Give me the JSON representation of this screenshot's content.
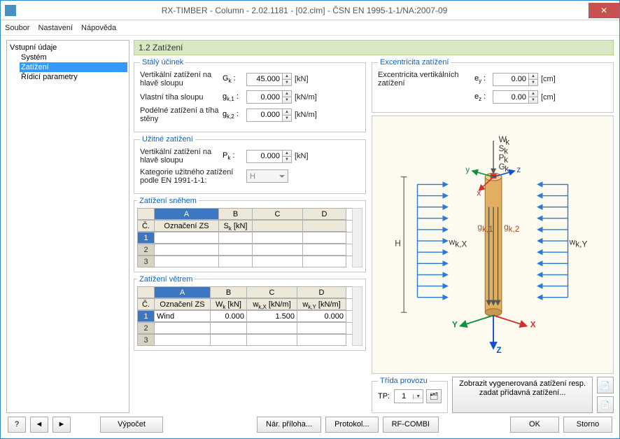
{
  "title": "RX-TIMBER - Column - 2.02.1181 - [02.clm] - ČSN EN 1995-1-1/NA:2007-09",
  "menu": {
    "file": "Soubor",
    "settings": "Nastavení",
    "help": "Nápověda"
  },
  "tree": {
    "root": "Vstupní údaje",
    "items": [
      "Systém",
      "Zatížení",
      "Řídicí parametry"
    ],
    "selected": "Zatížení"
  },
  "heading": "1.2 Zatížení",
  "perm": {
    "legend": "Stálý účinek",
    "r1_label": "Vertikální zatížení na hlavě sloupu",
    "r1_sym": "G<sub>k</sub> :",
    "r1_val": "45.000",
    "r1_unit": "[kN]",
    "r2_label": "Vlastní tíha sloupu",
    "r2_sym": "g<sub>k,1</sub> :",
    "r2_val": "0.000",
    "r2_unit": "[kN/m]",
    "r3_label": "Podélné zatížení a tíha stěny",
    "r3_sym": "g<sub>k,2</sub> :",
    "r3_val": "0.000",
    "r3_unit": "[kN/m]"
  },
  "live": {
    "legend": "Užitné zatížení",
    "r1_label": "Vertikální zatížení na hlavě sloupu",
    "r1_sym": "P<sub>k</sub> :",
    "r1_val": "0.000",
    "r1_unit": "[kN]",
    "r2_label": "Kategorie užitného zatížení podle EN 1991-1-1:",
    "r2_val": "H"
  },
  "snow": {
    "legend": "Zatížení sněhem",
    "cols": {
      "num": "Č.",
      "a_letter": "A",
      "b_letter": "B",
      "c_letter": "C",
      "d_letter": "D",
      "a": "Označení ZS",
      "b": "S<sub>k</sub> [kN]",
      "c": "",
      "d": ""
    },
    "rows": [
      {
        "n": "1",
        "a": "",
        "b": "",
        "c": "",
        "d": ""
      },
      {
        "n": "2",
        "a": "",
        "b": "",
        "c": "",
        "d": ""
      },
      {
        "n": "3",
        "a": "",
        "b": "",
        "c": "",
        "d": ""
      }
    ]
  },
  "wind": {
    "legend": "Zatížení větrem",
    "cols": {
      "num": "Č.",
      "a_letter": "A",
      "b_letter": "B",
      "c_letter": "C",
      "d_letter": "D",
      "a": "Označení ZS",
      "b": "W<sub>k</sub> [kN]",
      "c": "w<sub>k,X</sub> [kN/m]",
      "d": "w<sub>k,Y</sub> [kN/m]"
    },
    "rows": [
      {
        "n": "1",
        "a": "Wind",
        "b": "0.000",
        "c": "1.500",
        "d": "0.000"
      },
      {
        "n": "2",
        "a": "",
        "b": "",
        "c": "",
        "d": ""
      },
      {
        "n": "3",
        "a": "",
        "b": "",
        "c": "",
        "d": ""
      }
    ]
  },
  "ecc": {
    "legend": "Excentricita zatížení",
    "r1_label": "Excentricita vertikálních zatížení",
    "ey_sym": "e<sub>y</sub> :",
    "ey_val": "0.00",
    "ey_unit": "[cm]",
    "ez_sym": "e<sub>z</sub> :",
    "ez_val": "0.00",
    "ez_unit": "[cm]"
  },
  "tp": {
    "legend": "Třída provozu",
    "label": "TP:",
    "value": "1"
  },
  "gen_btn": "Zobrazit vygenerovaná zatížení resp.\nzadat přídavná zatížení...",
  "footer": {
    "calc": "Výpočet",
    "nar": "Nár. příloha...",
    "protokol": "Protokol...",
    "combi": "RF-COMBI",
    "ok": "OK",
    "storno": "Storno"
  },
  "diag_labels": {
    "Wk": "W<sub>k</sub>",
    "Sk": "S<sub>k</sub>",
    "Pk": "P<sub>k</sub>",
    "Gk": "G<sub>k</sub>",
    "gk1": "g<sub>k,1</sub>",
    "gk2": "g<sub>k,2</sub>",
    "wkX": "w<sub>k,X</sub>",
    "wkY": "w<sub>k,Y</sub>",
    "H": "H",
    "X": "X",
    "Y": "Y",
    "Z": "Z",
    "x": "x",
    "y": "y",
    "z": "z"
  }
}
